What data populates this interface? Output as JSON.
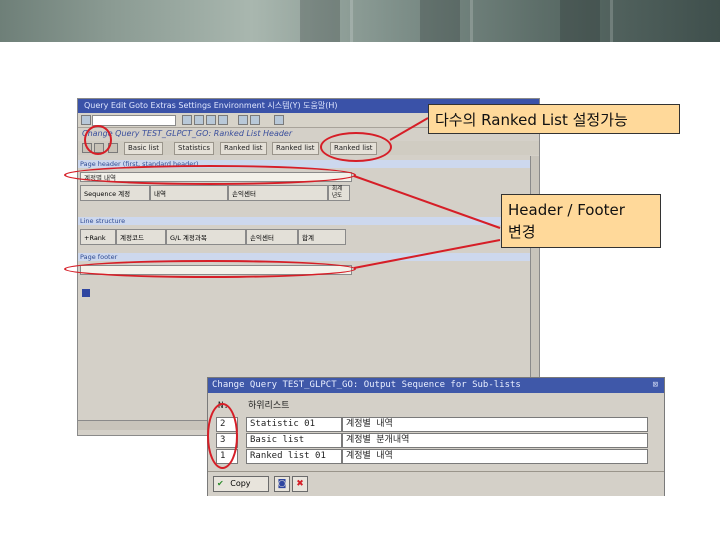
{
  "callouts": {
    "ranked": "다수의 Ranked List 설정가능",
    "header_footer_line1": "Header / Footer",
    "header_footer_line2": "변경"
  },
  "sap": {
    "menubar": "Query  Edit  Goto  Extras  Settings  Environment  시스템(Y)  도움말(H)",
    "title": "Change Query TEST_GLPCT_GO: Ranked List Header",
    "toolbar": {
      "basic_list": "Basic list",
      "statistics": "Statistics",
      "ranked_list": "Ranked list",
      "ranked_list2": "Ranked list",
      "ranked_list3": "Ranked list"
    },
    "sections": {
      "page_header": "Page header (first, standard header)",
      "line_structure": "Line structure",
      "page_footer": "Page footer"
    },
    "header_fields": {
      "line1": "계정별 내역",
      "sequence": "Sequence 계정",
      "col2": "내역",
      "col3": "손익센터",
      "col4": "회계",
      "col4b": "년도"
    },
    "line_fields": {
      "rank": "+Rank",
      "f1": "계정코드",
      "f2": "G/L 계정과목",
      "f3": "손익센터",
      "f4": "합계"
    }
  },
  "dialog": {
    "title": "Change Query TEST_GLPCT_GO: Output Sequence for Sub-lists",
    "close": "⊠",
    "header_no": "N.",
    "header_name": "하위리스트",
    "rows": [
      {
        "no": "2",
        "name": "Statistic 01",
        "desc": "계정별 내역"
      },
      {
        "no": "3",
        "name": "Basic list",
        "desc": "계정별 분개내역"
      },
      {
        "no": "1",
        "name": "Ranked list 01",
        "desc": "계정별 내역"
      }
    ],
    "copy_label": "Copy",
    "check_icon": "✔",
    "cancel_icon": "✖"
  },
  "colors": {
    "oval": "#d61e27",
    "callout_bg": "#ffd99a",
    "sap_blue": "#3a52a8"
  }
}
